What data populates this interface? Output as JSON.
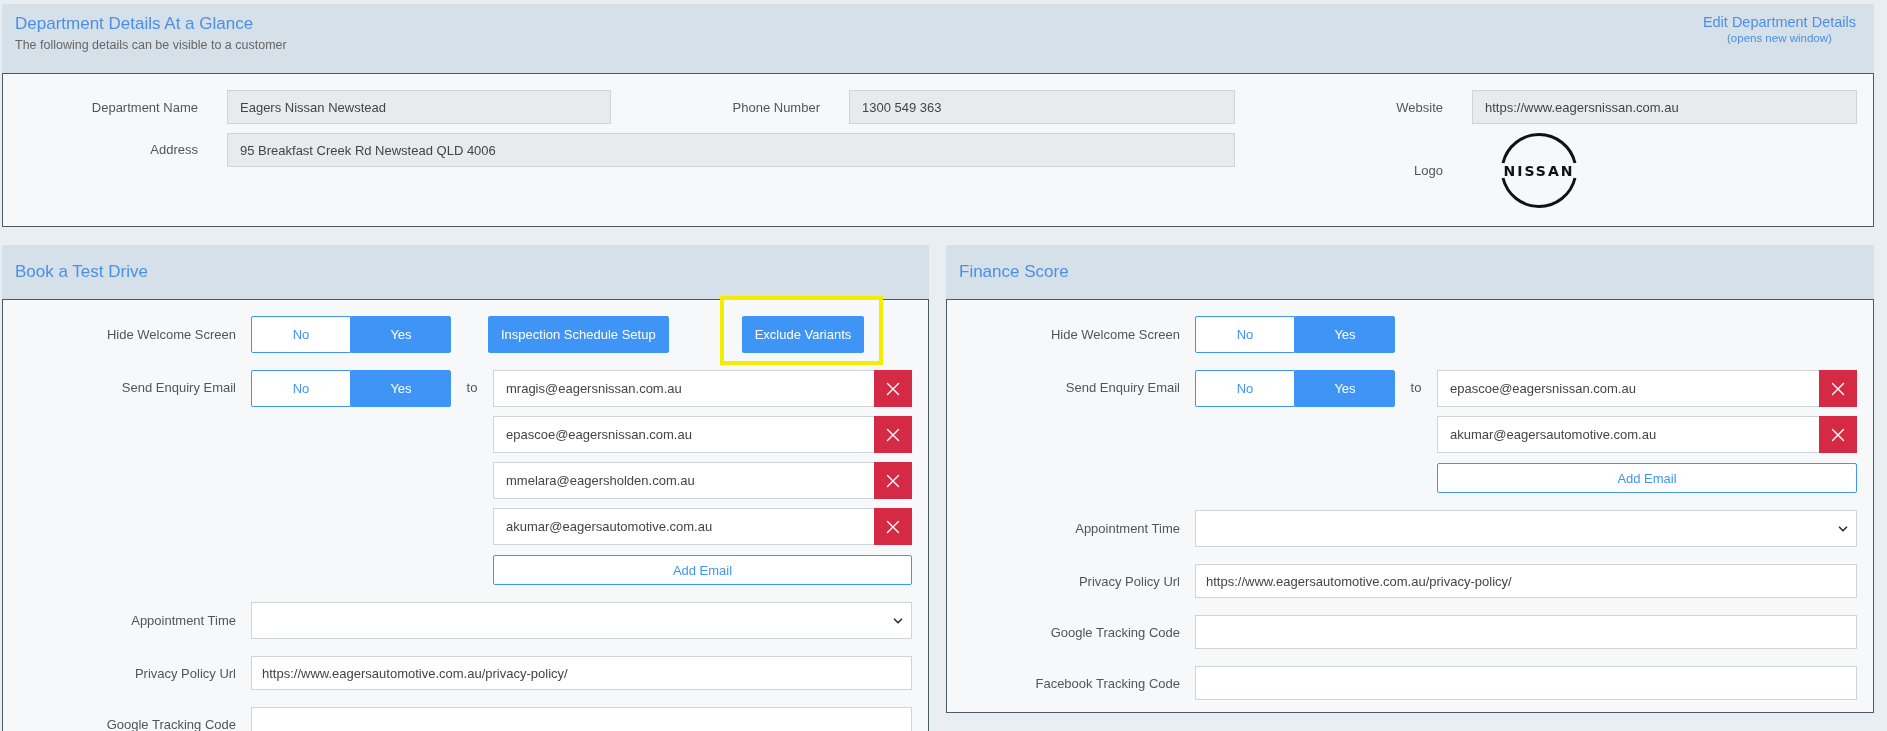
{
  "department": {
    "title": "Department Details At a Glance",
    "subtitle": "The following details can be visible to a customer",
    "edit_link": "Edit Department Details",
    "edit_note": "(opens new window)",
    "fields": [
      {
        "label": "Department Name",
        "value": "Eagers Nissan Newstead"
      },
      {
        "label": "Phone Number",
        "value": "1300 549 363"
      },
      {
        "label": "Website",
        "value": "https://www.eagersnissan.com.au"
      },
      {
        "label": "Address",
        "value": "95 Breakfast Creek Rd Newstead QLD 4006"
      }
    ],
    "logo": {
      "label": "Logo",
      "text": "NISSAN"
    }
  },
  "panels": [
    {
      "title": "Book a Test Drive",
      "hide_welcome": {
        "label": "Hide Welcome Screen",
        "options": [
          {
            "label": "No",
            "selected": false
          },
          {
            "label": "Yes",
            "selected": true
          }
        ]
      },
      "buttons": [
        {
          "label": "Inspection Schedule Setup",
          "highlighted": false
        },
        {
          "label": "Exclude Variants",
          "highlighted": true
        }
      ],
      "send_enquiry": {
        "label": "Send Enquiry Email",
        "options": [
          {
            "label": "No",
            "selected": false
          },
          {
            "label": "Yes",
            "selected": true
          }
        ]
      },
      "to_label": "to",
      "emails": [
        "mragis@eagersnissan.com.au",
        "epascoe@eagersnissan.com.au",
        "mmelara@eagersholden.com.au",
        "akumar@eagersautomotive.com.au"
      ],
      "add_email": "Add Email",
      "fields": [
        {
          "kind": "select",
          "label": "Appointment Time"
        },
        {
          "kind": "text",
          "label": "Privacy Policy Url",
          "value": "https://www.eagersautomotive.com.au/privacy-policy/"
        },
        {
          "kind": "text",
          "label": "Google Tracking Code"
        }
      ]
    },
    {
      "title": "Finance Score",
      "hide_welcome": {
        "label": "Hide Welcome Screen",
        "options": [
          {
            "label": "No",
            "selected": false
          },
          {
            "label": "Yes",
            "selected": true
          }
        ]
      },
      "send_enquiry": {
        "label": "Send Enquiry Email",
        "options": [
          {
            "label": "No",
            "selected": false
          },
          {
            "label": "Yes",
            "selected": true
          }
        ]
      },
      "to_label": "to",
      "emails": [
        "epascoe@eagersnissan.com.au",
        "akumar@eagersautomotive.com.au"
      ],
      "add_email": "Add Email",
      "fields": [
        {
          "kind": "select",
          "label": "Appointment Time"
        },
        {
          "kind": "text",
          "label": "Privacy Policy Url",
          "value": "https://www.eagersautomotive.com.au/privacy-policy/"
        },
        {
          "kind": "text",
          "label": "Google Tracking Code"
        },
        {
          "kind": "text",
          "label": "Facebook Tracking Code"
        }
      ]
    }
  ]
}
